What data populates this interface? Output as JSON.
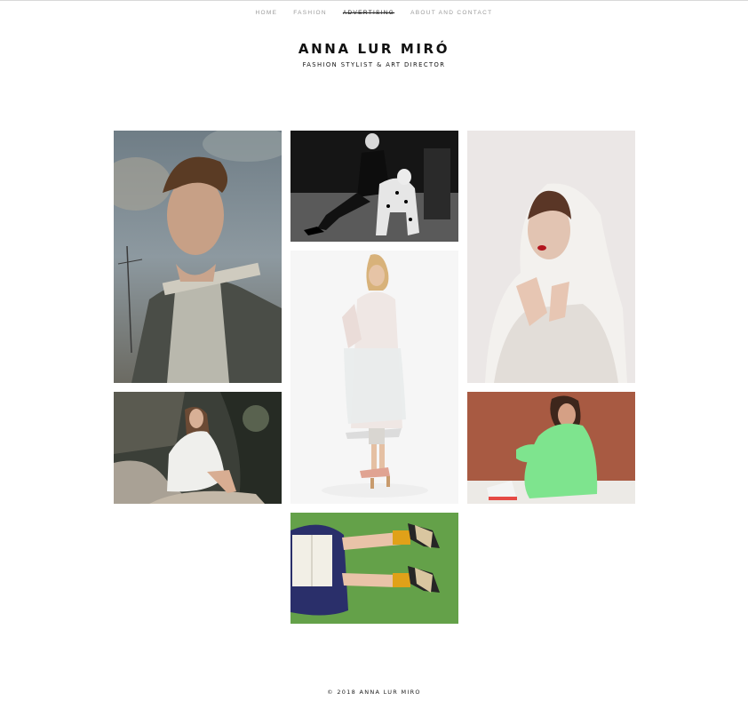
{
  "nav": {
    "items": [
      {
        "label": "HOME"
      },
      {
        "label": "FASHION"
      },
      {
        "label": "ADVERTISING",
        "active": true
      },
      {
        "label": "ABOUT AND CONTACT"
      }
    ]
  },
  "brand": {
    "name": "ANNA LUR MIRÓ",
    "tagline": "FASHION STYLIST & ART DIRECTOR"
  },
  "gallery": [
    {
      "subject": "man-with-backpack-sky"
    },
    {
      "subject": "bw-woman-with-dalmatian"
    },
    {
      "subject": "woman-in-white-fur"
    },
    {
      "subject": "woman-in-sheer-coat"
    },
    {
      "subject": "woman-on-rocks-white-dress"
    },
    {
      "subject": "woman-green-sweater-rust-wall"
    },
    {
      "subject": "legs-on-grass-with-book"
    }
  ],
  "footer": {
    "copyright": "© 2018 ANNA LUR MIRO"
  }
}
